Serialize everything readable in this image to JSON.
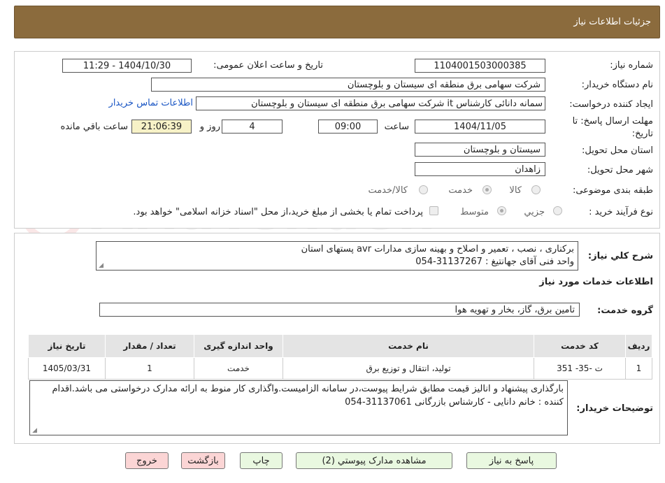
{
  "header": {
    "title": "جزئیات اطلاعات نیاز"
  },
  "form": {
    "need_number_label": "شماره نیاز:",
    "need_number": "1104001503000385",
    "announce_label": "تاریخ و ساعت اعلان عمومی:",
    "announce_value": "1404/10/30 - 11:29",
    "buyer_label": "نام دستگاه خریدار:",
    "buyer_value": "شرکت سهامی برق منطقه ای سیستان و بلوچستان",
    "creator_label": "ایجاد کننده درخواست:",
    "creator_value": "سمانه دانائی کارشناس it شرکت سهامی برق منطقه ای سیستان و بلوچستان",
    "contact_link": "اطلاعات تماس خریدار",
    "deadline_label": "مهلت ارسال پاسخ: تا تاریخ:",
    "deadline_date": "1404/11/05",
    "time_label": "ساعت",
    "deadline_time": "09:00",
    "days_value": "4",
    "days_label": "روز و",
    "remaining_time": "21:06:39",
    "remaining_label": "ساعت باقي مانده",
    "province_label": "استان محل تحویل:",
    "province_value": "سیستان و بلوچستان",
    "city_label": "شهر محل تحویل:",
    "city_value": "زاهدان",
    "category_label": "طبقه بندی موضوعی:",
    "category_options": [
      "کالا",
      "خدمت",
      "کالا/خدمت"
    ],
    "category_selected": "خدمت",
    "process_label": "نوع فرآیند خرید :",
    "process_options": [
      "جزیي",
      "متوسط"
    ],
    "process_selected": "متوسط",
    "payment_note": "پرداخت تمام یا بخشی از مبلغ خرید،از محل \"اسناد خزانه اسلامی\" خواهد بود."
  },
  "details": {
    "summary_label": "شرح كلي نیاز:",
    "summary_line1": "برکناری ، نصب ، تعمیر و اصلاح و بهینه سازی مدارات avr پستهای استان",
    "summary_line2": "واحد فنی آقای جهانتیغ : 31137267-054",
    "services_title": "اطلاعات خدمات مورد نیاز",
    "service_group_label": "گروه خدمت:",
    "service_group_value": "تامین برق، گاز، بخار و تهویه هوا"
  },
  "table": {
    "headers": [
      "ردیف",
      "کد خدمت",
      "نام خدمت",
      "واحد اندازه گیری",
      "تعداد / مقدار",
      "تاریخ نیاز"
    ],
    "rows": [
      [
        "1",
        "ت -35- 351",
        "تولید، انتقال و توزیع برق",
        "خدمت",
        "1",
        "1405/03/31"
      ]
    ]
  },
  "buyer_notes": {
    "label": "توضیحات خریدار:",
    "text": "بارگذاری پیشنهاد و انالیز قیمت مطابق شرایط پیوست،در سامانه الزامیست.واگذاری کار منوط به ارائه مدارک درخواستی می باشد.اقدام کننده : خانم دانایی - کارشناس بازرگانی 31137061-054"
  },
  "buttons": {
    "reply": "پاسخ به نیاز",
    "attachments": "مشاهده مدارک پیوستي (2)",
    "print": "چاپ",
    "back": "بازگشت",
    "exit": "خروج"
  },
  "watermark": {
    "text": "AriaTender.neT"
  }
}
